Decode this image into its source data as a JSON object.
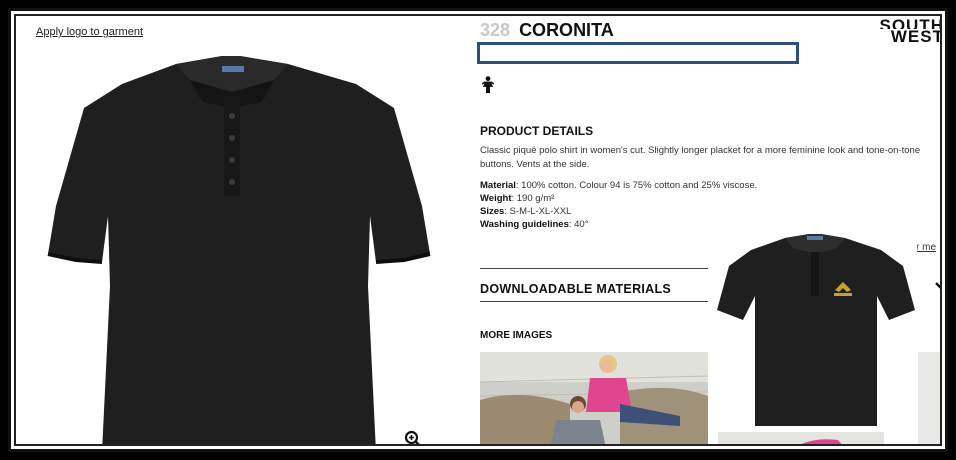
{
  "apply_link": "Apply logo to garment",
  "product": {
    "number": "328",
    "name": "CORONITA",
    "brand_line1": "SOUTH",
    "brand_line2": "WEST"
  },
  "details": {
    "heading": "PRODUCT DETAILS",
    "description": "Classic piqué polo shirt in women's cut. Slightly longer placket for a more feminine look and tone-on-tone buttons. Vents at the side.",
    "material_label": "Material",
    "material_value": ": 100% cotton. Colour 94 is 75% cotton and 25% viscose.",
    "weight_label": "Weight",
    "weight_value": ": 190 g/m²",
    "sizes_label": "Sizes",
    "sizes_value": ": S-M-L-XL-XXL",
    "washing_label": "Washing guidelines",
    "washing_value": ": 40°",
    "more_link": "r me"
  },
  "downloadable_heading": "DOWNLOADABLE MATERIALS",
  "more_images_heading": "MORE IMAGES",
  "colors": {
    "shirt": "#1f1f1f",
    "highlight": "#2f4d7e",
    "logo": "#c9a12a",
    "pink": "#e0468f"
  },
  "icons": [
    "zoom-in-icon",
    "female-icon",
    "chevron-down-icon"
  ]
}
